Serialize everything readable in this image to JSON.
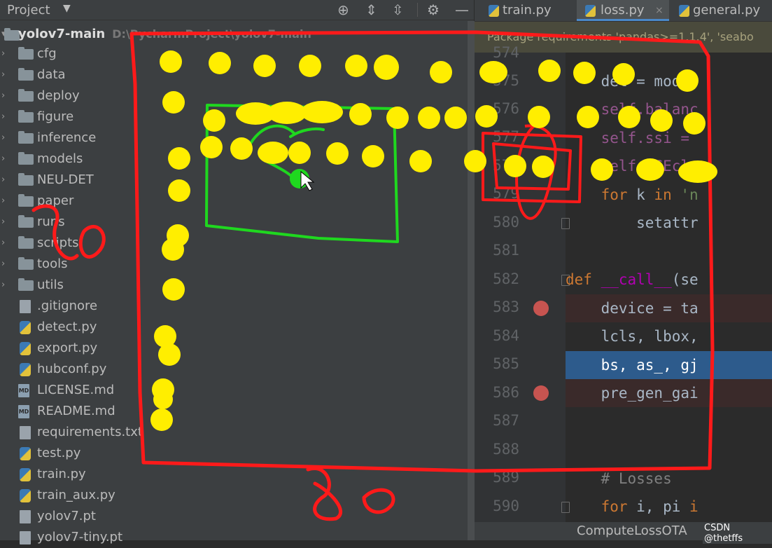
{
  "project_panel": {
    "title": "Project",
    "root": {
      "name": "yolov7-main",
      "path": "D:\\PycharmProject\\yolov7-main"
    },
    "folders": [
      "cfg",
      "data",
      "deploy",
      "figure",
      "inference",
      "models",
      "NEU-DET",
      "paper",
      "runs",
      "scripts",
      "tools",
      "utils"
    ],
    "files": [
      {
        "name": ".gitignore",
        "kind": "git"
      },
      {
        "name": "detect.py",
        "kind": "py"
      },
      {
        "name": "export.py",
        "kind": "py"
      },
      {
        "name": "hubconf.py",
        "kind": "py"
      },
      {
        "name": "LICENSE.md",
        "kind": "md"
      },
      {
        "name": "README.md",
        "kind": "md"
      },
      {
        "name": "requirements.txt",
        "kind": "txt"
      },
      {
        "name": "test.py",
        "kind": "py"
      },
      {
        "name": "train.py",
        "kind": "py"
      },
      {
        "name": "train_aux.py",
        "kind": "py"
      },
      {
        "name": "yolov7.pt",
        "kind": "pt"
      },
      {
        "name": "yolov7-tiny.pt",
        "kind": "pt"
      }
    ]
  },
  "toolbar_icons": [
    "locate-icon",
    "expand-all-icon",
    "collapse-all-icon",
    "gear-icon",
    "minimize-icon"
  ],
  "editor": {
    "tabs": [
      {
        "label": "train.py",
        "active": false
      },
      {
        "label": "loss.py",
        "active": true
      },
      {
        "label": "general.py",
        "active": false
      }
    ],
    "banner": "Package requirements 'pandas>=1.1.4', 'seabo",
    "line_numbers": [
      "574",
      "575",
      "576",
      "577",
      "578",
      "579",
      "580",
      "581",
      "582",
      "583",
      "584",
      "585",
      "586",
      "587",
      "588",
      "589",
      "590"
    ],
    "breakpoint_lines": [
      "583",
      "586"
    ],
    "current_line": "585",
    "code": {
      "l575": "    det = model",
      "l576": "    self.balanc",
      "l577": "    self.ssi = ",
      "l578": "    self.BCEcls",
      "l579a": "    for",
      "l579b": " k ",
      "l579c": "in",
      "l579d": " 'n",
      "l580": "        setattr",
      "l582a": "def ",
      "l582b": "__call__",
      "l582c": "(se",
      "l583": "    device = ta",
      "l584": "    lcls, lbox,",
      "l585": "    bs, as_, gj",
      "l586": "    pre_gen_gai",
      "l589": "    # Losses",
      "l590a": "    for",
      "l590b": " i, pi ",
      "l590c": "i"
    },
    "breadcrumb": "ComputeLossOTA",
    "watermark": "CSDN @thetffs"
  },
  "colors": {
    "annotation_red": "#ff1a1a",
    "annotation_green": "#1fd81f",
    "annotation_yellow": "#ffee00"
  }
}
